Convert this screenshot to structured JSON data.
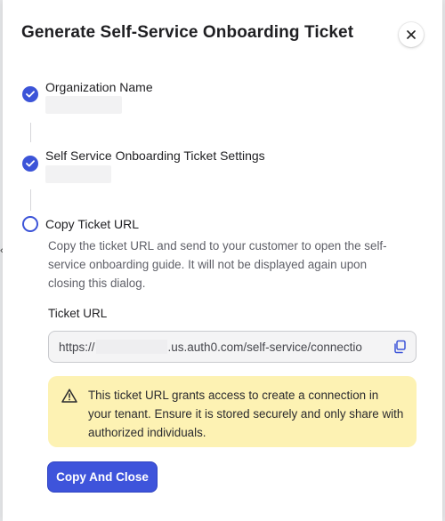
{
  "dialog": {
    "title": "Generate Self-Service Onboarding Ticket"
  },
  "steps": [
    {
      "label": "Organization Name",
      "status": "complete"
    },
    {
      "label": "Self Service Onboarding Ticket Settings",
      "status": "complete"
    },
    {
      "label": "Copy Ticket URL",
      "status": "current",
      "description": "Copy the ticket URL and send to your customer to open the self-service onboarding guide. It will not be displayed again upon closing this dialog."
    }
  ],
  "ticket_url": {
    "label": "Ticket URL",
    "prefix": "https://",
    "suffix": ".us.auth0.com/self-service/connectio"
  },
  "warning": {
    "text": "This ticket URL grants access to create a connection in your tenant. Ensure it is stored securely and only share with authorized individuals."
  },
  "actions": {
    "copy_and_close": "Copy And Close"
  },
  "colors": {
    "accent": "#3c54d8",
    "warning_bg": "#fdf2b3"
  },
  "icons": {
    "close": "close-icon",
    "check": "check-icon",
    "copy": "copy-icon",
    "warning": "warning-triangle-icon"
  }
}
